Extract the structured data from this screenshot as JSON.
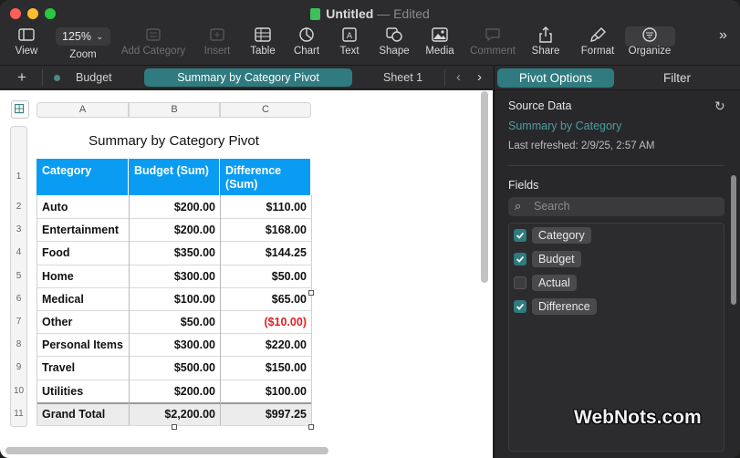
{
  "window": {
    "title": "Untitled",
    "status": "Edited"
  },
  "toolbar": {
    "view": "View",
    "zoom_value": "125%",
    "zoom": "Zoom",
    "add_category": "Add Category",
    "insert": "Insert",
    "table": "Table",
    "chart": "Chart",
    "text": "Text",
    "shape": "Shape",
    "media": "Media",
    "comment": "Comment",
    "share": "Share",
    "format": "Format",
    "organize": "Organize"
  },
  "sheets": {
    "add": "+",
    "tabs": [
      "Budget",
      "Summary by Category Pivot",
      "Sheet 1"
    ],
    "active": "Summary by Category Pivot"
  },
  "sheet_table": {
    "title": "Summary by Category Pivot",
    "col_letters": [
      "A",
      "B",
      "C"
    ],
    "headers": [
      "Category",
      "Budget (Sum)",
      "Difference (Sum)"
    ],
    "header_line1": "Difference",
    "header_line2": "(Sum)",
    "row_numbers": [
      "1",
      "2",
      "3",
      "4",
      "5",
      "6",
      "7",
      "8",
      "9",
      "10",
      "11"
    ],
    "rows": [
      [
        "Auto",
        "$200.00",
        "$110.00"
      ],
      [
        "Entertainment",
        "$200.00",
        "$168.00"
      ],
      [
        "Food",
        "$350.00",
        "$144.25"
      ],
      [
        "Home",
        "$300.00",
        "$50.00"
      ],
      [
        "Medical",
        "$100.00",
        "$65.00"
      ],
      [
        "Other",
        "$50.00",
        "($10.00)"
      ],
      [
        "Personal Items",
        "$300.00",
        "$220.00"
      ],
      [
        "Travel",
        "$500.00",
        "$150.00"
      ],
      [
        "Utilities",
        "$200.00",
        "$100.00"
      ]
    ],
    "total": [
      "Grand Total",
      "$2,200.00",
      "$997.25"
    ],
    "header_color": "#0a9cf2",
    "negative_color": "#e0201f"
  },
  "panel": {
    "tabs": [
      "Pivot Options",
      "Filter"
    ],
    "active_tab": "Pivot Options",
    "source_label": "Source Data",
    "source_name": "Summary by Category",
    "refreshed": "Last refreshed: 2/9/25, 2:57 AM",
    "fields_label": "Fields",
    "search_placeholder": "Search",
    "fields": [
      {
        "name": "Category",
        "checked": true
      },
      {
        "name": "Budget",
        "checked": true
      },
      {
        "name": "Actual",
        "checked": false
      },
      {
        "name": "Difference",
        "checked": true
      }
    ],
    "accent": "#2f7b80"
  },
  "watermark": "WebNots.com"
}
